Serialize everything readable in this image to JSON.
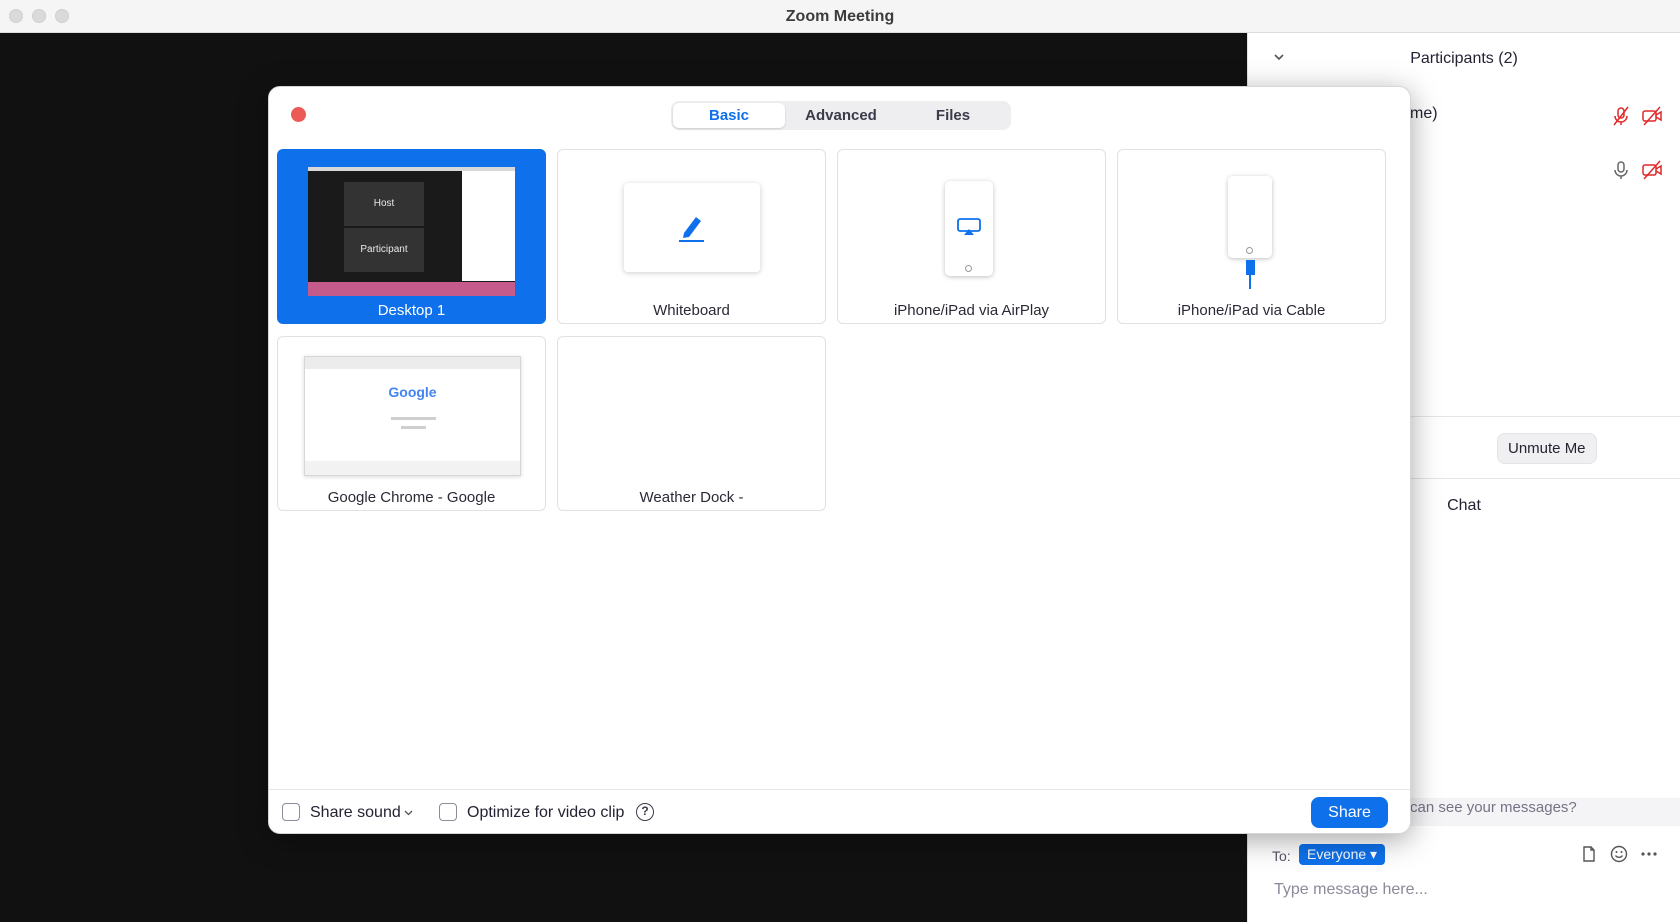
{
  "window": {
    "title": "Zoom Meeting"
  },
  "participants_panel": {
    "title": "Participants (2)",
    "rows": [
      {
        "name_fragment": "me)"
      },
      {
        "name_fragment": ""
      }
    ],
    "unmute_label": "Unmute Me"
  },
  "chat_panel": {
    "title": "Chat",
    "notice": "can see your messages?",
    "to_label": "To:",
    "recipient": "Everyone",
    "input_placeholder": "Type message here..."
  },
  "share_dialog": {
    "tabs": [
      {
        "label": "Basic",
        "active": true
      },
      {
        "label": "Advanced",
        "active": false
      },
      {
        "label": "Files",
        "active": false
      }
    ],
    "tiles": [
      {
        "label": "Desktop 1",
        "selected": true,
        "host_text": "Host",
        "participant_text": "Participant"
      },
      {
        "label": "Whiteboard",
        "selected": false
      },
      {
        "label": "iPhone/iPad via AirPlay",
        "selected": false
      },
      {
        "label": "iPhone/iPad via Cable",
        "selected": false
      },
      {
        "label": "Google Chrome - Google",
        "selected": false,
        "thumb_text": "Google"
      },
      {
        "label": "Weather Dock -",
        "selected": false
      }
    ],
    "footer": {
      "share_sound_label": "Share sound",
      "optimize_label": "Optimize for video clip",
      "help_glyph": "?",
      "share_label": "Share"
    }
  },
  "colors": {
    "accent": "#0e71eb",
    "danger": "#e02828",
    "close_dot": "#ec5a55"
  }
}
